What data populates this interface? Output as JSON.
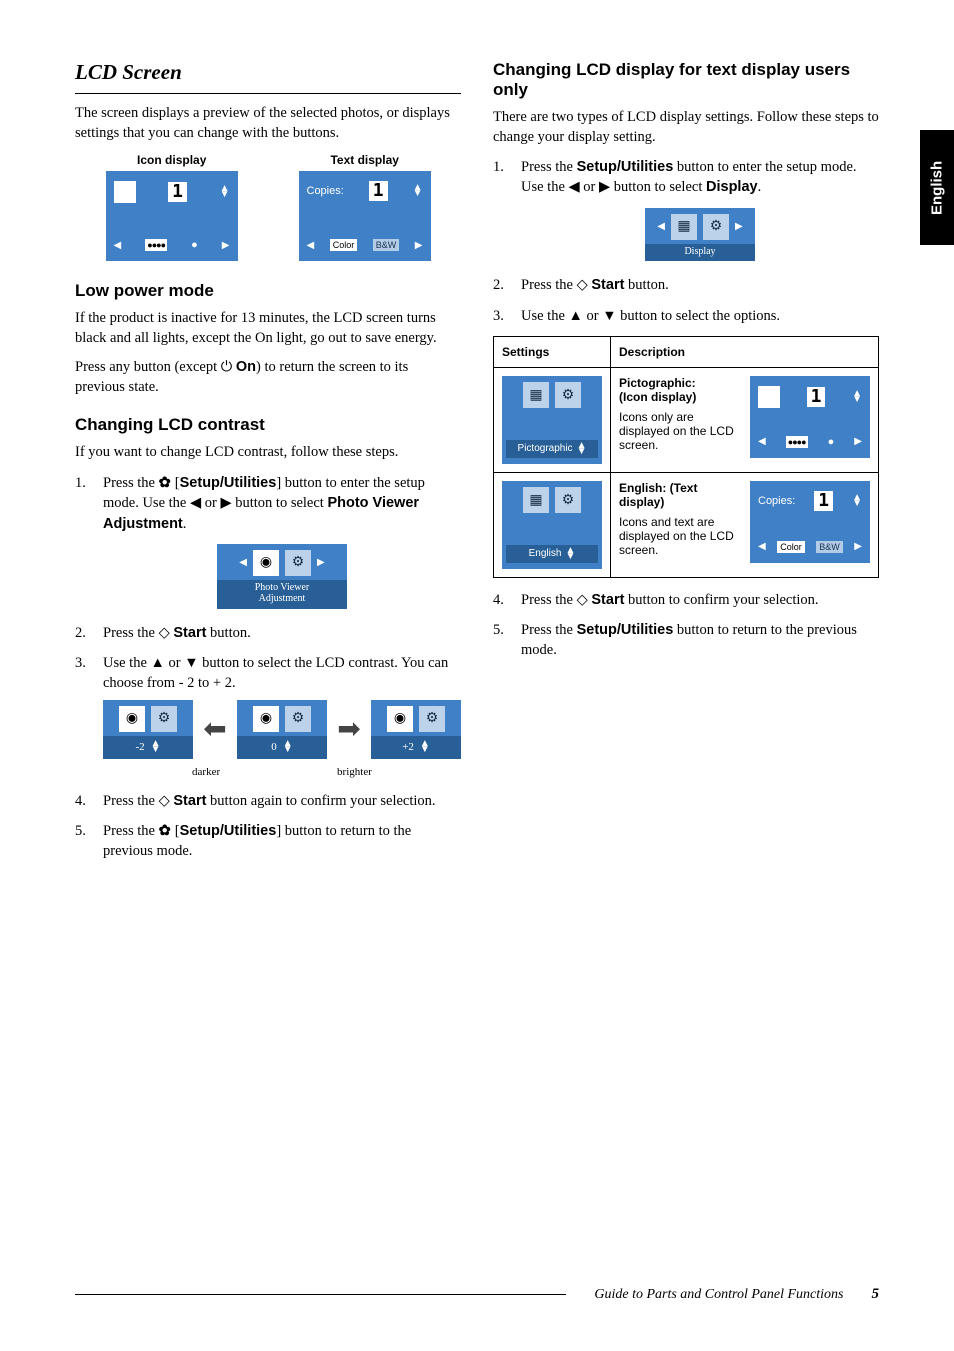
{
  "sideTab": "English",
  "left": {
    "h1": "LCD Screen",
    "intro": "The screen displays a preview of the selected photos, or displays settings that you can change with the buttons.",
    "iconDisplayLabel": "Icon display",
    "textDisplayLabel": "Text display",
    "lcd1": {
      "one": "1",
      "copies": "Copies:",
      "color": "Color",
      "bw": "B&W"
    },
    "lowPower": {
      "h2": "Low power mode",
      "p1": "If the product is inactive for 13 minutes, the LCD screen turns black and all lights, except the On light, go out to save energy.",
      "p2_pre": "Press any button (except ",
      "p2_on": "On",
      "p2_post": ") to return the screen to its previous state."
    },
    "contrast": {
      "h2": "Changing LCD contrast",
      "p1": "If you want to change LCD contrast, follow these steps.",
      "s1_pre": "Press the ",
      "s1_btn": "Setup/Utilities",
      "s1_mid": "] button to enter the setup mode. Use the ◀ or ▶ button to select ",
      "s1_end": "Photo Viewer Adjustment",
      "s1_dot": ".",
      "miniCaption": "Photo Viewer\nAdjustment",
      "s2_pre": "Press the ",
      "s2_btn": "Start",
      "s2_post": " button.",
      "s3": "Use the ▲ or ▼ button to select the LCD contrast. You can choose from - 2 to + 2.",
      "vals": {
        "neg2": "-2",
        "zero": "0",
        "pos2": "+2"
      },
      "darker": "darker",
      "brighter": "brighter",
      "s4_pre": "Press the ",
      "s4_btn": "Start",
      "s4_post": " button again to confirm your selection.",
      "s5_pre": "Press the ",
      "s5_btn": "Setup/Utilities",
      "s5_post": "] button to return to the previous mode."
    }
  },
  "right": {
    "h2": "Changing LCD display for text display users only",
    "intro": "There are two types of LCD display settings. Follow these steps to change your display setting.",
    "s1_pre": "Press the ",
    "s1_btn": "Setup/Utilities",
    "s1_mid": " button to enter the setup mode. Use the ◀ or ▶ button to select ",
    "s1_end": "Display",
    "s1_dot": ".",
    "miniCaption": "Display",
    "s2_pre": "Press the ",
    "s2_btn": "Start",
    "s2_post": " button.",
    "s3": "Use the ▲ or ▼ button to select the options.",
    "table": {
      "th1": "Settings",
      "th2": "Description",
      "row1": {
        "label": "Pictographic",
        "descTitle": "Pictographic:\n(Icon display)",
        "descBody": "Icons only are displayed on the LCD screen."
      },
      "row2": {
        "label": "English",
        "descTitle": "English: (Text display)",
        "descBody": "Icons and text are displayed on the LCD screen.",
        "copies": "Copies:",
        "color": "Color",
        "bw": "B&W",
        "one": "1"
      }
    },
    "s4_pre": "Press the ",
    "s4_btn": "Start",
    "s4_post": " button to confirm your selection.",
    "s5_pre": "Press the ",
    "s5_btn": "Setup/Utilities",
    "s5_post": " button to return to the previous mode."
  },
  "footer": {
    "title": "Guide to Parts and Control Panel Functions",
    "page": "5"
  }
}
